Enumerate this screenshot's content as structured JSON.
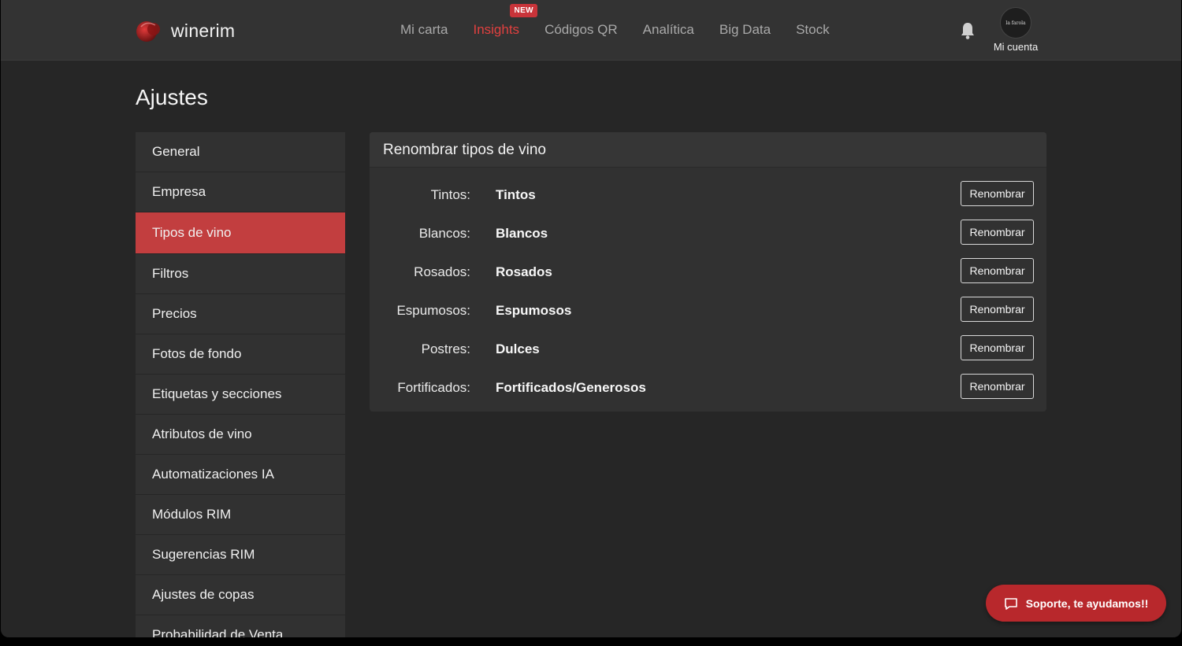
{
  "app": {
    "name": "winerim"
  },
  "nav": {
    "items": [
      {
        "label": "Mi carta",
        "active": false
      },
      {
        "label": "Insights",
        "active": true,
        "badge": "NEW"
      },
      {
        "label": "Códigos QR",
        "active": false
      },
      {
        "label": "Analítica",
        "active": false
      },
      {
        "label": "Big Data",
        "active": false
      },
      {
        "label": "Stock",
        "active": false
      }
    ]
  },
  "account": {
    "label": "Mi cuenta",
    "avatar_text": "la farola"
  },
  "page": {
    "title": "Ajustes"
  },
  "sidebar": {
    "items": [
      {
        "label": "General"
      },
      {
        "label": "Empresa"
      },
      {
        "label": "Tipos de vino",
        "active": true
      },
      {
        "label": "Filtros"
      },
      {
        "label": "Precios"
      },
      {
        "label": "Fotos de fondo"
      },
      {
        "label": "Etiquetas y secciones"
      },
      {
        "label": "Atributos de vino"
      },
      {
        "label": "Automatizaciones IA"
      },
      {
        "label": "Módulos RIM"
      },
      {
        "label": "Sugerencias RIM"
      },
      {
        "label": "Ajustes de copas"
      },
      {
        "label": "Probabilidad de Venta"
      }
    ]
  },
  "panel": {
    "title": "Renombrar tipos de vino",
    "button_label": "Renombrar",
    "rows": [
      {
        "label": "Tintos:",
        "value": "Tintos"
      },
      {
        "label": "Blancos:",
        "value": "Blancos"
      },
      {
        "label": "Rosados:",
        "value": "Rosados"
      },
      {
        "label": "Espumosos:",
        "value": "Espumosos"
      },
      {
        "label": "Postres:",
        "value": "Dulces"
      },
      {
        "label": "Fortificados:",
        "value": "Fortificados/Generosos"
      }
    ]
  },
  "support": {
    "label": "Soporte, te ayudamos!!"
  },
  "colors": {
    "accent": "#e0403f",
    "active_bg": "#c23e3f",
    "support_bg": "#b8282c"
  }
}
